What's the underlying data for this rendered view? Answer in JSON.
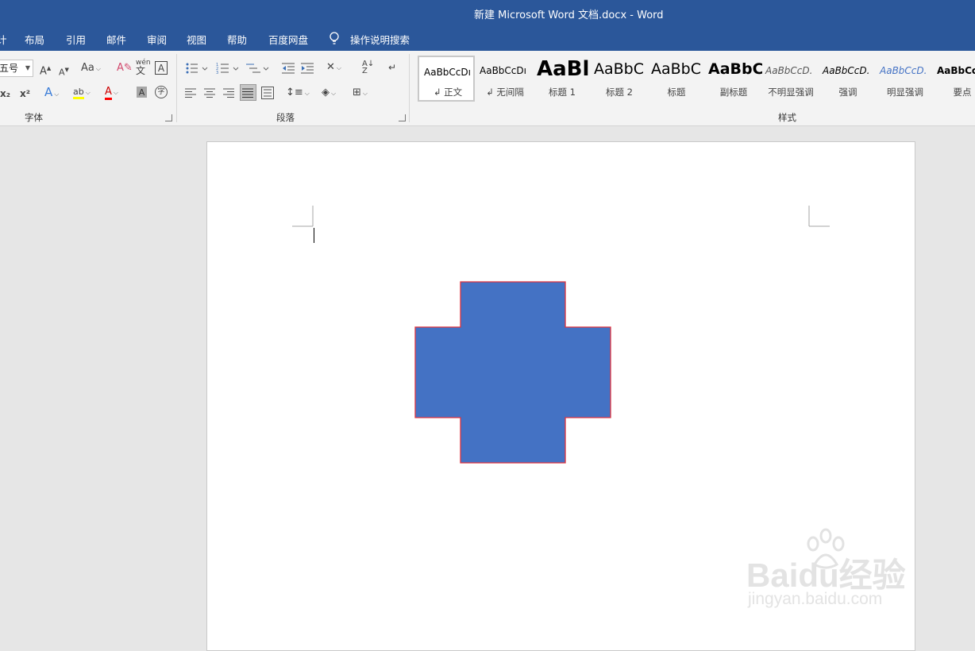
{
  "window": {
    "title": "新建 Microsoft Word 文档.docx  -  Word"
  },
  "menu": {
    "cut_off": "计",
    "items": [
      "布局",
      "引用",
      "邮件",
      "审阅",
      "视图",
      "帮助",
      "百度网盘"
    ],
    "tell_me": "操作说明搜索"
  },
  "ribbon": {
    "font_group": {
      "label": "字体",
      "font_size": "五号",
      "change_case": "Aa",
      "phonetic_top": "wén",
      "phonetic_bottom": "文",
      "char_border": "A",
      "subscript": "x₂",
      "superscript": "x²",
      "text_effect": "A",
      "highlight": "ab",
      "font_color": "A",
      "char_shading": "A",
      "enclose": "字"
    },
    "paragraph_group": {
      "label": "段落"
    },
    "styles_group": {
      "label": "样式",
      "items": [
        {
          "preview": "AaBbCcDı",
          "name": "↲ 正文"
        },
        {
          "preview": "AaBbCcDı",
          "name": "↲ 无间隔"
        },
        {
          "preview": "AaBl",
          "name": "标题 1"
        },
        {
          "preview": "AaBbC",
          "name": "标题 2"
        },
        {
          "preview": "AaBbC",
          "name": "标题"
        },
        {
          "preview": "AaBbC",
          "name": "副标题"
        },
        {
          "preview": "AaBbCcD.",
          "name": "不明显强调"
        },
        {
          "preview": "AaBbCcD.",
          "name": "强调"
        },
        {
          "preview": "AaBbCcD.",
          "name": "明显强调"
        },
        {
          "preview": "AaBbCc",
          "name": "要点"
        }
      ]
    }
  },
  "document": {
    "shape": {
      "type": "cross",
      "fill": "#4472c4",
      "stroke": "#e0333e"
    }
  },
  "watermark": {
    "brand": "Baidu经验",
    "url": "jingyan.baidu.com"
  },
  "colors": {
    "accent": "#2b579a",
    "highlight_yellow": "#ffff00",
    "font_red": "#ff0000"
  }
}
